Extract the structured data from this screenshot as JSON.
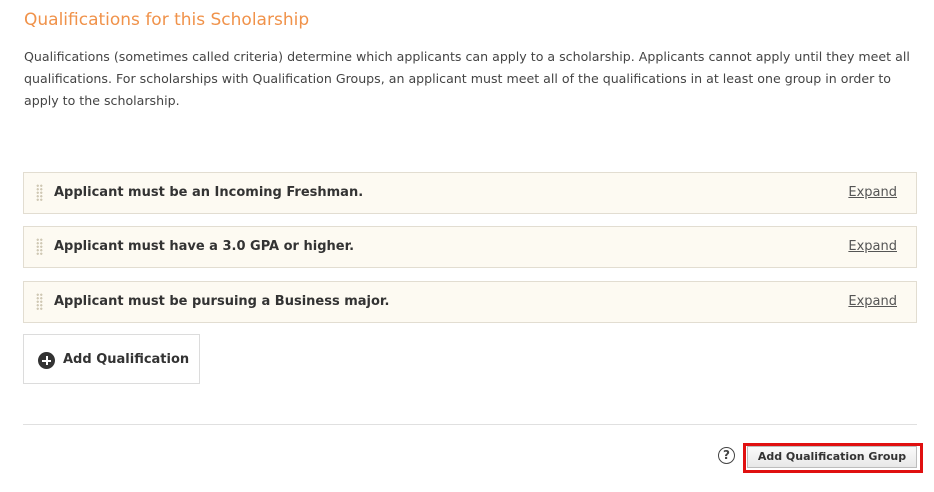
{
  "section": {
    "title": "Qualifications for this Scholarship",
    "description": "Qualifications (sometimes called criteria) determine which applicants can apply to a scholarship. Applicants cannot apply until they meet all qualifications. For scholarships with Qualification Groups, an applicant must meet all of the qualifications in at least one group in order to apply to the scholarship."
  },
  "qualifications": [
    {
      "label": "Applicant must be an Incoming Freshman.",
      "action": "Expand"
    },
    {
      "label": "Applicant must have a 3.0 GPA or higher.",
      "action": "Expand"
    },
    {
      "label": "Applicant must be pursuing a Business major.",
      "action": "Expand"
    }
  ],
  "buttons": {
    "add_qualification": "Add Qualification",
    "add_group": "Add Qualification Group",
    "help_glyph": "?"
  },
  "icons": {
    "plus": "plus-circle-icon",
    "help": "question-circle-icon",
    "drag": "drag-handle-icon"
  },
  "colors": {
    "title": "#f0924a",
    "row_background": "#fdfaf2",
    "highlight": "#e01010"
  }
}
